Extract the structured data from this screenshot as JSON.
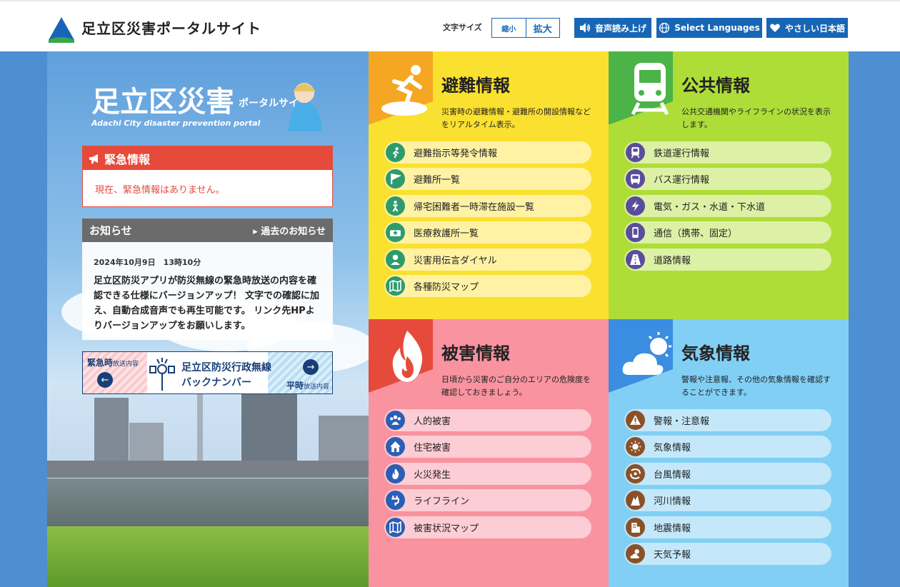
{
  "header": {
    "site_title": "足立区災害ポータルサイト",
    "font_size_label": "文字サイズ",
    "font_small": "縮小",
    "font_large": "拡大",
    "read_aloud": "音声読み上げ",
    "select_languages": "Select Languages",
    "easy_japanese": "やさしい日本語"
  },
  "sidebar": {
    "logo_main": "足立区災害",
    "logo_sub": "ポータルサイト",
    "logo_en": "Adachi City disaster prevention portal",
    "emergency": {
      "title": "緊急情報",
      "message": "現在、緊急情報はありません。"
    },
    "news": {
      "title": "お知らせ",
      "past_link": "過去のお知らせ",
      "date": "2024年10月9日　13時10分",
      "body": "足立区防災アプリが防災無線の緊急時放送の内容を確認できる仕様にバージョンアップ！ 文字での確認に加え、自動合成音声でも再生可能です。 リンク先HPよりバージョンアップをお願いします。"
    },
    "banner": {
      "left_main": "緊急時",
      "left_sub": "放送内容",
      "title_line1": "足立区防災行政無線",
      "title_line2": "バックナンバー",
      "right_main": "平時",
      "right_sub": "放送内容"
    }
  },
  "panels": {
    "evacuation": {
      "title": "避難情報",
      "desc": "災害時の避難情報・避難所の開設情報などをリアルタイム表示。",
      "items": [
        {
          "label": "避難指示等発令情報",
          "icon": "runner-icon"
        },
        {
          "label": "避難所一覧",
          "icon": "flag-icon"
        },
        {
          "label": "帰宅困難者一時滞在施設一覧",
          "icon": "person-icon"
        },
        {
          "label": "医療救護所一覧",
          "icon": "ambulance-icon"
        },
        {
          "label": "災害用伝言ダイヤル",
          "icon": "user-icon"
        },
        {
          "label": "各種防災マップ",
          "icon": "map-icon"
        }
      ]
    },
    "public": {
      "title": "公共情報",
      "desc": "公共交通機関やライフラインの状況を表示します。",
      "items": [
        {
          "label": "鉄道運行情報",
          "icon": "train-icon"
        },
        {
          "label": "バス運行情報",
          "icon": "bus-icon"
        },
        {
          "label": "電気・ガス・水道・下水道",
          "icon": "lightning-icon"
        },
        {
          "label": "通信（携帯、固定）",
          "icon": "phone-icon"
        },
        {
          "label": "道路情報",
          "icon": "road-icon"
        }
      ]
    },
    "damage": {
      "title": "被害情報",
      "desc": "日頃から災害のご自分のエリアの危険度を確認しておきましょう。",
      "items": [
        {
          "label": "人的被害",
          "icon": "people-icon"
        },
        {
          "label": "住宅被害",
          "icon": "house-icon"
        },
        {
          "label": "火災発生",
          "icon": "fire-icon"
        },
        {
          "label": "ライフライン",
          "icon": "plug-icon"
        },
        {
          "label": "被害状況マップ",
          "icon": "map-icon"
        }
      ]
    },
    "weather": {
      "title": "気象情報",
      "desc": "警報や注意報、その他の気象情報を確認することができます。",
      "items": [
        {
          "label": "警報・注意報",
          "icon": "warning-icon"
        },
        {
          "label": "気象情報",
          "icon": "sun-icon"
        },
        {
          "label": "台風情報",
          "icon": "typhoon-icon"
        },
        {
          "label": "河川情報",
          "icon": "river-icon"
        },
        {
          "label": "地震情報",
          "icon": "building-icon"
        },
        {
          "label": "天気予報",
          "icon": "weather-icon"
        }
      ]
    }
  },
  "colors": {
    "brand_blue": "#1766b6",
    "emergency_red": "#e64a3b",
    "evacuation_yellow": "#fbe12f",
    "public_green": "#aedd38",
    "damage_pink": "#f8939f",
    "weather_blue": "#81cff4"
  }
}
